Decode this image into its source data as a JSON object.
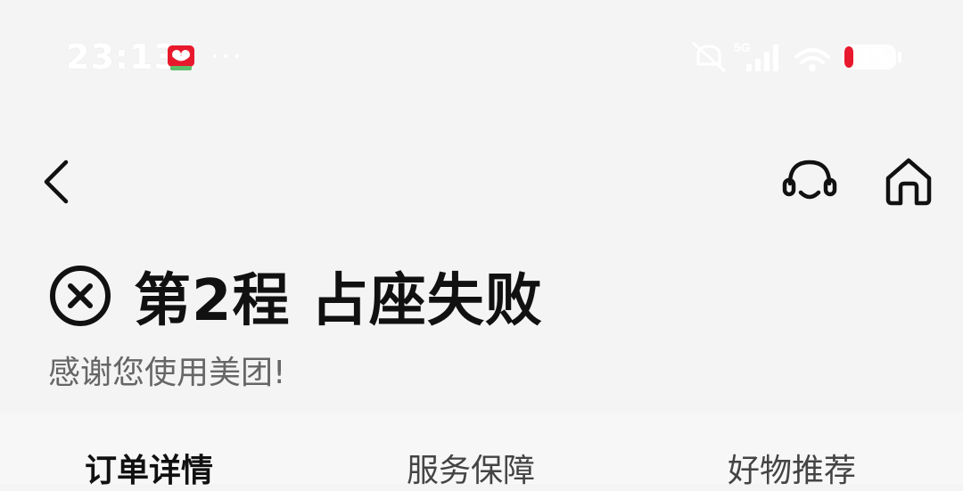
{
  "status_bar": {
    "time": "23:13",
    "more": "···",
    "network": "5G",
    "battery": "16"
  },
  "colors": {
    "battery_red": "#e8192c",
    "fail_icon": "#111111",
    "subtitle": "#666666"
  },
  "icons": {
    "back": "chevron-left-icon",
    "service": "headset-icon",
    "home": "home-icon",
    "fail": "close-circle-icon"
  },
  "header": {
    "title": "第2程 占座失败",
    "subtitle": "感谢您使用美团!"
  },
  "tabs": [
    {
      "label": "订单详情",
      "active": true
    },
    {
      "label": "服务保障",
      "active": false
    },
    {
      "label": "好物推荐",
      "active": false
    }
  ]
}
